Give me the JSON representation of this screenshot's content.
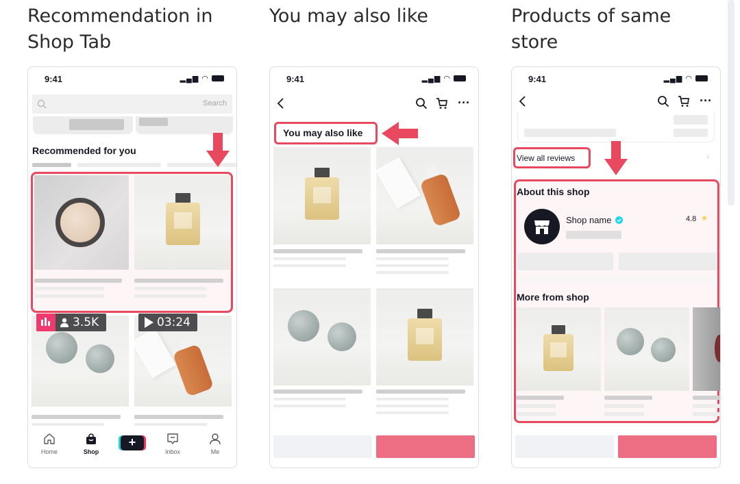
{
  "headings": {
    "col1": "Recommendation in Shop Tab",
    "col2": "You may also like",
    "col3": "Products of same store"
  },
  "status_time": "9:41",
  "phone1": {
    "search_placeholder": "Search",
    "section_title": "Recommended for you",
    "live_viewers": "3.5K",
    "video_duration": "03:24",
    "nav": [
      {
        "label": "Home",
        "icon": "home-icon"
      },
      {
        "label": "Shop",
        "icon": "shop-bag-icon"
      },
      {
        "label": "",
        "icon": "create-plus-icon"
      },
      {
        "label": "Inbox",
        "icon": "inbox-icon"
      },
      {
        "label": "Me",
        "icon": "profile-icon"
      }
    ]
  },
  "phone2": {
    "title": "You may also like"
  },
  "phone3": {
    "view_all_reviews": "View all reviews",
    "about_shop": "About this shop",
    "shop_name": "Shop name",
    "rating": "4.8",
    "more_from_shop": "More from shop"
  },
  "colors": {
    "highlight": "#e8495f",
    "cta": "#ed6d82",
    "live_badge": "#ee3a6e"
  }
}
